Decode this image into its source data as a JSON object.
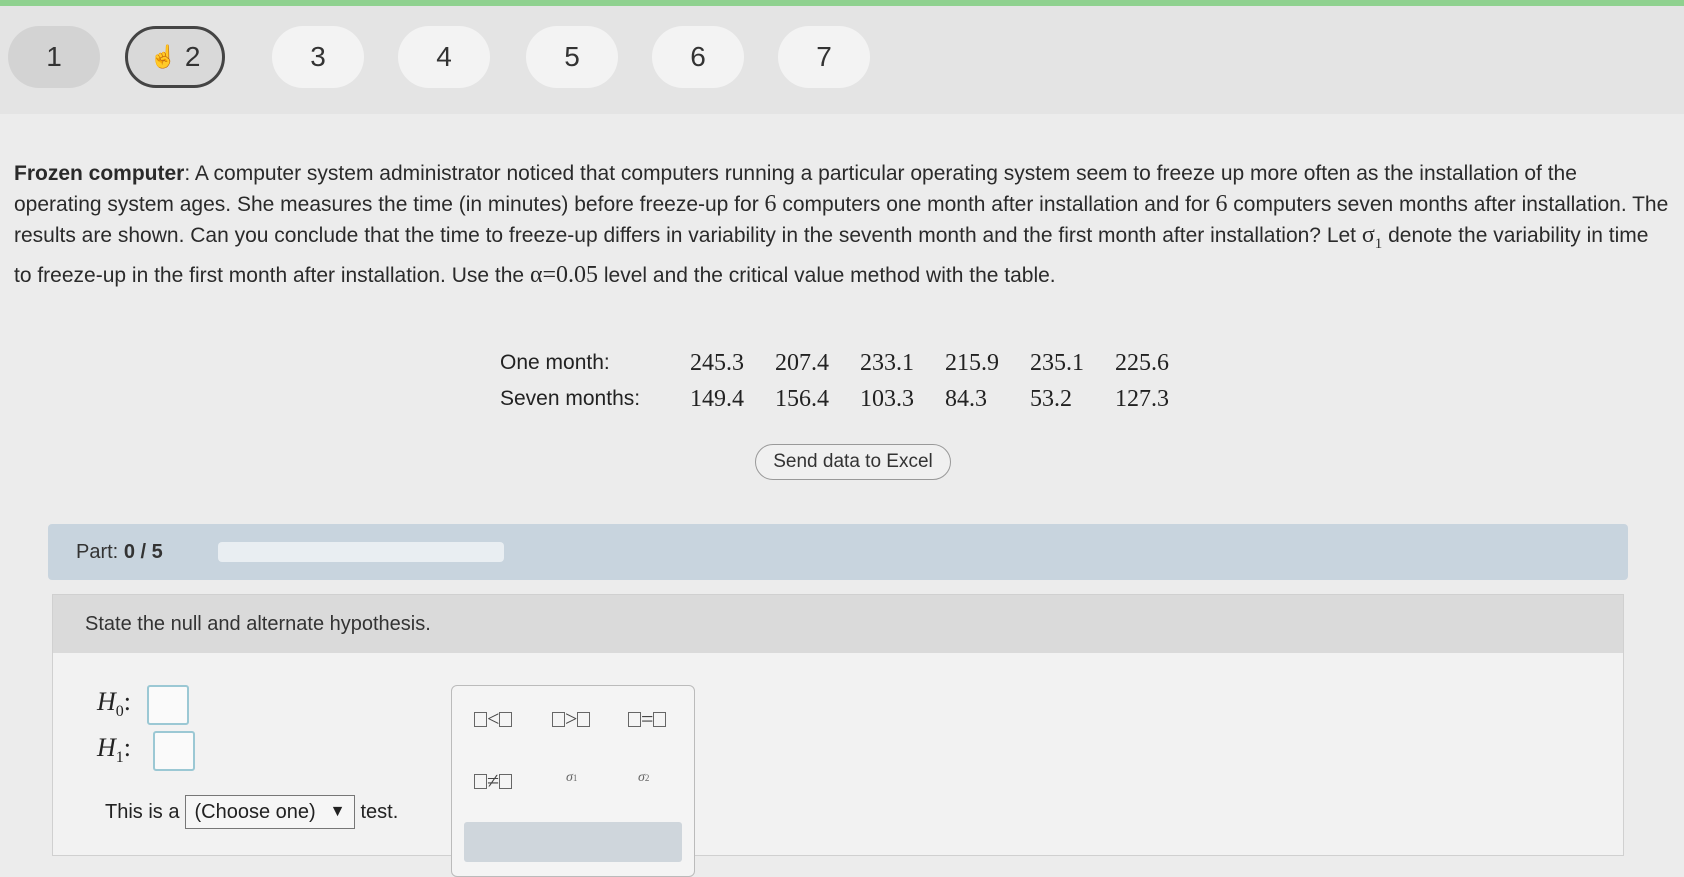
{
  "nav": {
    "questions": [
      {
        "label": "1",
        "state": "done"
      },
      {
        "label": "2",
        "state": "current"
      },
      {
        "label": "3",
        "state": "todo"
      },
      {
        "label": "4",
        "state": "todo"
      },
      {
        "label": "5",
        "state": "todo"
      },
      {
        "label": "6",
        "state": "todo"
      },
      {
        "label": "7",
        "state": "todo"
      }
    ]
  },
  "problem": {
    "title": "Frozen computer",
    "text1": ": A computer system administrator noticed that computers running a particular operating system seem to freeze up more often as the installation of the operating system ages. She measures the time (in minutes) before freeze-up for ",
    "n1": "6",
    "text2": " computers one month after installation and for ",
    "n2": "6",
    "text3": " computers seven months after installation. The results are shown. Can you conclude that the time to freeze-up differs in variability in the seventh month and the first month after installation? Let ",
    "sigma": "σ",
    "sigma_sub": "1",
    "text4": " denote the variability in time to freeze-up in the first month after installation. Use the ",
    "alpha": "α=0.05",
    "text5": " level and the critical value method with the table."
  },
  "data_table": {
    "rows": [
      {
        "label": "One month:",
        "values": [
          "245.3",
          "207.4",
          "233.1",
          "215.9",
          "235.1",
          "225.6"
        ]
      },
      {
        "label": "Seven months:",
        "values": [
          "149.4",
          "156.4",
          "103.3",
          "84.3",
          "53.2",
          "127.3"
        ]
      }
    ]
  },
  "excel_button": "Send data to Excel",
  "part": {
    "label": "Part:",
    "progress": "0 / 5",
    "fraction": 0
  },
  "task": {
    "instruction": "State the null and alternate hypothesis.",
    "h0": "H",
    "h0_sub": "0",
    "h1": "H",
    "h1_sub": "1",
    "colon": ":",
    "this_is_a": "This is a",
    "select_value": "(Choose one)",
    "test": "test."
  },
  "palette": {
    "lt": "<",
    "gt": ">",
    "eq": "=",
    "ne": "≠",
    "sigma1": "σ",
    "sigma1_sub": "1",
    "sigma2": "σ",
    "sigma2_sub": "2"
  }
}
